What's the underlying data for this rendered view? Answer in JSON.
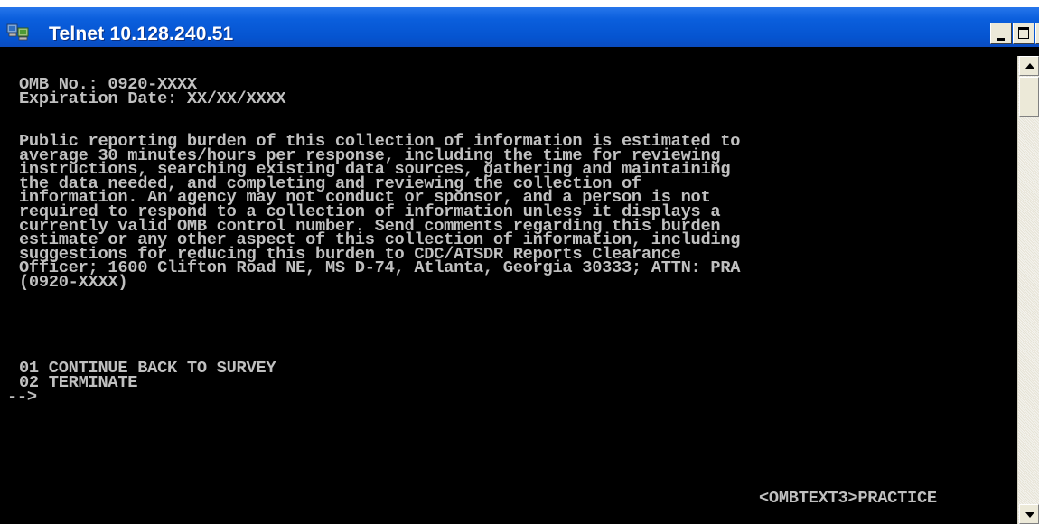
{
  "window": {
    "title": "Telnet 10.128.240.51",
    "icon": "telnet-terminal-icon",
    "controls": {
      "minimize": "minimize-icon",
      "maximize": "maximize-icon",
      "close": "×"
    }
  },
  "header": {
    "omb_number": "OMB No.: 0920-XXXX",
    "expiration": "Expiration Date: XX/XX/XXXX"
  },
  "burden_statement": [
    "Public reporting burden of this collection of information is estimated to",
    "average 30 minutes/hours per response, including the time for reviewing",
    "instructions, searching existing data sources, gathering and maintaining",
    "the data needed, and completing and reviewing the collection of",
    "information. An agency may not conduct or sponsor, and a person is not",
    "required to respond to a collection of information unless it displays a",
    "currently valid OMB control number. Send comments regarding this burden",
    "estimate or any other aspect of this collection of information, including",
    "suggestions for reducing this burden to CDC/ATSDR Reports Clearance",
    "Officer; 1600 Clifton Road NE, MS D-74, Atlanta, Georgia 30333; ATTN: PRA",
    "(0920-XXXX)"
  ],
  "menu": [
    {
      "label": "01 CONTINUE BACK TO SURVEY"
    },
    {
      "label": "02 TERMINATE"
    }
  ],
  "prompt": "-->",
  "status": "<OMBTEXT3>PRACTICE",
  "colors": {
    "console_bg": "#000000",
    "console_text": "#c0c0c0",
    "titlebar": "#0554d0"
  }
}
